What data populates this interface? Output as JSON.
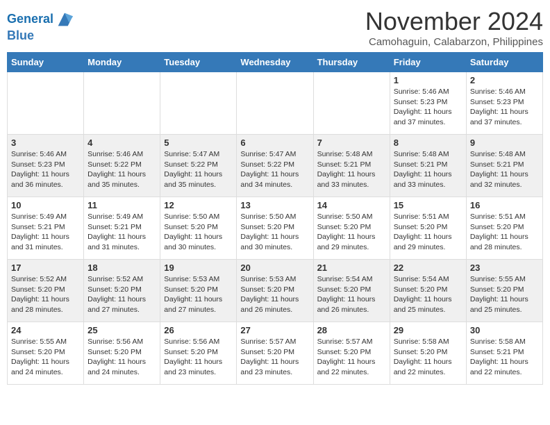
{
  "logo": {
    "line1": "General",
    "line2": "Blue"
  },
  "title": "November 2024",
  "subtitle": "Camohaguin, Calabarzon, Philippines",
  "headers": [
    "Sunday",
    "Monday",
    "Tuesday",
    "Wednesday",
    "Thursday",
    "Friday",
    "Saturday"
  ],
  "weeks": [
    [
      {
        "day": "",
        "info": ""
      },
      {
        "day": "",
        "info": ""
      },
      {
        "day": "",
        "info": ""
      },
      {
        "day": "",
        "info": ""
      },
      {
        "day": "",
        "info": ""
      },
      {
        "day": "1",
        "info": "Sunrise: 5:46 AM\nSunset: 5:23 PM\nDaylight: 11 hours\nand 37 minutes."
      },
      {
        "day": "2",
        "info": "Sunrise: 5:46 AM\nSunset: 5:23 PM\nDaylight: 11 hours\nand 37 minutes."
      }
    ],
    [
      {
        "day": "3",
        "info": "Sunrise: 5:46 AM\nSunset: 5:23 PM\nDaylight: 11 hours\nand 36 minutes."
      },
      {
        "day": "4",
        "info": "Sunrise: 5:46 AM\nSunset: 5:22 PM\nDaylight: 11 hours\nand 35 minutes."
      },
      {
        "day": "5",
        "info": "Sunrise: 5:47 AM\nSunset: 5:22 PM\nDaylight: 11 hours\nand 35 minutes."
      },
      {
        "day": "6",
        "info": "Sunrise: 5:47 AM\nSunset: 5:22 PM\nDaylight: 11 hours\nand 34 minutes."
      },
      {
        "day": "7",
        "info": "Sunrise: 5:48 AM\nSunset: 5:21 PM\nDaylight: 11 hours\nand 33 minutes."
      },
      {
        "day": "8",
        "info": "Sunrise: 5:48 AM\nSunset: 5:21 PM\nDaylight: 11 hours\nand 33 minutes."
      },
      {
        "day": "9",
        "info": "Sunrise: 5:48 AM\nSunset: 5:21 PM\nDaylight: 11 hours\nand 32 minutes."
      }
    ],
    [
      {
        "day": "10",
        "info": "Sunrise: 5:49 AM\nSunset: 5:21 PM\nDaylight: 11 hours\nand 31 minutes."
      },
      {
        "day": "11",
        "info": "Sunrise: 5:49 AM\nSunset: 5:21 PM\nDaylight: 11 hours\nand 31 minutes."
      },
      {
        "day": "12",
        "info": "Sunrise: 5:50 AM\nSunset: 5:20 PM\nDaylight: 11 hours\nand 30 minutes."
      },
      {
        "day": "13",
        "info": "Sunrise: 5:50 AM\nSunset: 5:20 PM\nDaylight: 11 hours\nand 30 minutes."
      },
      {
        "day": "14",
        "info": "Sunrise: 5:50 AM\nSunset: 5:20 PM\nDaylight: 11 hours\nand 29 minutes."
      },
      {
        "day": "15",
        "info": "Sunrise: 5:51 AM\nSunset: 5:20 PM\nDaylight: 11 hours\nand 29 minutes."
      },
      {
        "day": "16",
        "info": "Sunrise: 5:51 AM\nSunset: 5:20 PM\nDaylight: 11 hours\nand 28 minutes."
      }
    ],
    [
      {
        "day": "17",
        "info": "Sunrise: 5:52 AM\nSunset: 5:20 PM\nDaylight: 11 hours\nand 28 minutes."
      },
      {
        "day": "18",
        "info": "Sunrise: 5:52 AM\nSunset: 5:20 PM\nDaylight: 11 hours\nand 27 minutes."
      },
      {
        "day": "19",
        "info": "Sunrise: 5:53 AM\nSunset: 5:20 PM\nDaylight: 11 hours\nand 27 minutes."
      },
      {
        "day": "20",
        "info": "Sunrise: 5:53 AM\nSunset: 5:20 PM\nDaylight: 11 hours\nand 26 minutes."
      },
      {
        "day": "21",
        "info": "Sunrise: 5:54 AM\nSunset: 5:20 PM\nDaylight: 11 hours\nand 26 minutes."
      },
      {
        "day": "22",
        "info": "Sunrise: 5:54 AM\nSunset: 5:20 PM\nDaylight: 11 hours\nand 25 minutes."
      },
      {
        "day": "23",
        "info": "Sunrise: 5:55 AM\nSunset: 5:20 PM\nDaylight: 11 hours\nand 25 minutes."
      }
    ],
    [
      {
        "day": "24",
        "info": "Sunrise: 5:55 AM\nSunset: 5:20 PM\nDaylight: 11 hours\nand 24 minutes."
      },
      {
        "day": "25",
        "info": "Sunrise: 5:56 AM\nSunset: 5:20 PM\nDaylight: 11 hours\nand 24 minutes."
      },
      {
        "day": "26",
        "info": "Sunrise: 5:56 AM\nSunset: 5:20 PM\nDaylight: 11 hours\nand 23 minutes."
      },
      {
        "day": "27",
        "info": "Sunrise: 5:57 AM\nSunset: 5:20 PM\nDaylight: 11 hours\nand 23 minutes."
      },
      {
        "day": "28",
        "info": "Sunrise: 5:57 AM\nSunset: 5:20 PM\nDaylight: 11 hours\nand 22 minutes."
      },
      {
        "day": "29",
        "info": "Sunrise: 5:58 AM\nSunset: 5:20 PM\nDaylight: 11 hours\nand 22 minutes."
      },
      {
        "day": "30",
        "info": "Sunrise: 5:58 AM\nSunset: 5:21 PM\nDaylight: 11 hours\nand 22 minutes."
      }
    ]
  ]
}
